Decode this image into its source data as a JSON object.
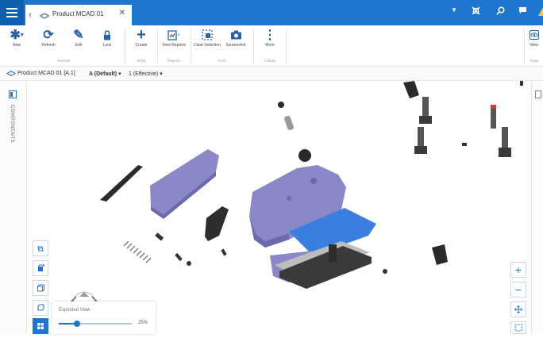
{
  "tab": {
    "title": "Product MCAD 01"
  },
  "ribbon": {
    "groups": [
      {
        "label": "General",
        "buttons": [
          {
            "label": "New"
          },
          {
            "label": "Refresh"
          },
          {
            "label": "Edit"
          },
          {
            "label": "Lock"
          }
        ]
      },
      {
        "label": "BOM",
        "buttons": [
          {
            "label": "Create"
          }
        ]
      },
      {
        "label": "Reports",
        "buttons": [
          {
            "label": "View Reports"
          }
        ]
      },
      {
        "label": "CAD",
        "buttons": [
          {
            "label": "Clear Selection"
          },
          {
            "label": "Screenshot"
          }
        ]
      },
      {
        "label": "Actions",
        "buttons": [
          {
            "label": "More"
          }
        ]
      },
      {
        "label": "Page",
        "buttons": [
          {
            "label": "View"
          }
        ]
      }
    ]
  },
  "breadcrumb": {
    "item": "Product MCAD 01 [A.1]",
    "revision": "A (Default)",
    "iteration": "1 (Effective)"
  },
  "left_panel": {
    "label": "COMPONENTS"
  },
  "exploded_view": {
    "label": "Exploded View",
    "value_text": "25%",
    "value": 0.25
  },
  "colors": {
    "brand": "#1e77cf",
    "part_purple": "#8a88c9",
    "part_blue": "#3a7fe0"
  }
}
